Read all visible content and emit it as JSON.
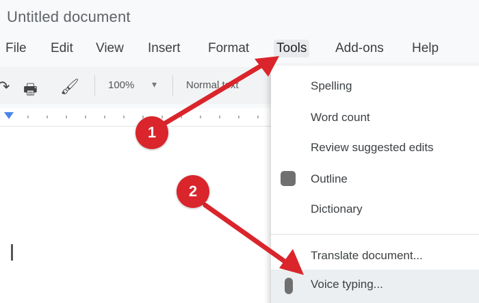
{
  "document": {
    "title": "Untitled document"
  },
  "menubar": {
    "items": [
      "File",
      "Edit",
      "View",
      "Insert",
      "Format",
      "Tools",
      "Add-ons",
      "Help"
    ],
    "active": "Tools"
  },
  "toolbar": {
    "zoom": "100%",
    "style": "Normal text"
  },
  "tools_menu": {
    "items": [
      {
        "label": "Spelling"
      },
      {
        "label": "Word count"
      },
      {
        "label": "Review suggested edits"
      },
      {
        "label": "Outline"
      },
      {
        "label": "Dictionary"
      },
      {
        "label": "Translate document..."
      },
      {
        "label": "Voice typing..."
      }
    ]
  },
  "annotations": {
    "step1": "1",
    "step2": "2",
    "color": "#d9252b"
  }
}
